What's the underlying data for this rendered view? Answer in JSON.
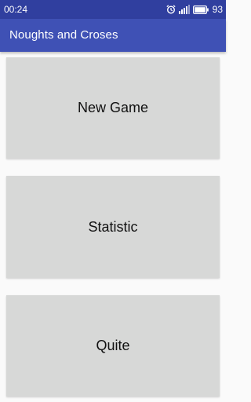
{
  "status_bar": {
    "time": "00:24",
    "battery_level": "93",
    "icons": [
      "alarm-icon",
      "signal-icon",
      "battery-icon"
    ]
  },
  "app_bar": {
    "title": "Noughts and Croses",
    "color": "#3f51b5"
  },
  "menu": {
    "new_game_label": "New Game",
    "statistic_label": "Statistic",
    "quit_label": "Quite"
  }
}
